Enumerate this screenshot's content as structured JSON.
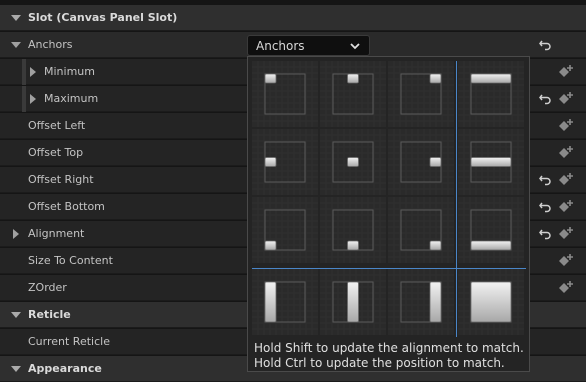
{
  "sections": {
    "slot": "Slot (Canvas Panel Slot)",
    "reticle": "Reticle",
    "appearance": "Appearance"
  },
  "props": {
    "anchors": "Anchors",
    "minimum": "Minimum",
    "maximum": "Maximum",
    "offset_left": "Offset Left",
    "offset_top": "Offset Top",
    "offset_right": "Offset Right",
    "offset_bottom": "Offset Bottom",
    "alignment": "Alignment",
    "size_to_content": "Size To Content",
    "zorder": "ZOrder",
    "current_reticle": "Current Reticle"
  },
  "anchors_combo": {
    "label": "Anchors"
  },
  "anchor_popup": {
    "hint_shift": "Hold Shift to update the alignment to match.",
    "hint_ctrl": "Hold Ctrl to update the position to match.",
    "presets": [
      "top-left",
      "top-center",
      "top-right",
      "top-stretch",
      "center-left",
      "center",
      "center-right",
      "center-stretch",
      "bottom-left",
      "bottom-center",
      "bottom-right",
      "bottom-stretch",
      "stretch-left",
      "stretch-center",
      "stretch-right",
      "stretch-full"
    ]
  },
  "icons": {
    "reset": "reset-arrow-icon",
    "keyframe": "add-keyframe-icon",
    "chevron": "chevron-down-icon"
  }
}
